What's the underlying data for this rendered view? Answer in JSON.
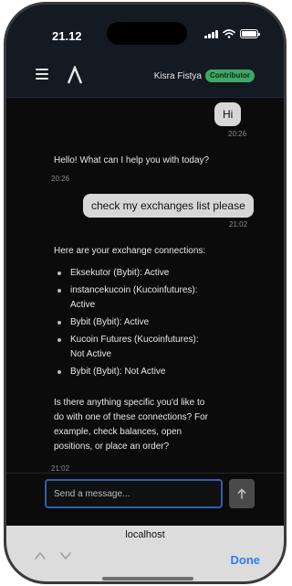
{
  "status_bar": {
    "time": "21.12"
  },
  "header": {
    "user_name": "Kisra Fistya",
    "role_badge": "Contributor",
    "badge_color": "#3ea864"
  },
  "messages": [
    {
      "role": "user",
      "text": "Hi",
      "time": "20:26"
    },
    {
      "role": "assistant",
      "text": "Hello! What can I help you with today?",
      "time": "20:26"
    },
    {
      "role": "user",
      "text": "check my exchanges list please",
      "time": "21:02"
    },
    {
      "role": "assistant",
      "intro": "Here are your exchange connections:",
      "connections": [
        {
          "line1": "Eksekutor (Bybit): Active",
          "line2": ""
        },
        {
          "line1": "instancekucoin (Kucoinfutures):",
          "line2": "Active"
        },
        {
          "line1": "Bybit (Bybit): Active",
          "line2": ""
        },
        {
          "line1": "Kucoin Futures (Kucoinfutures):",
          "line2": "Not Active"
        },
        {
          "line1": "Bybit (Bybit): Not Active",
          "line2": ""
        }
      ],
      "outro_lines": [
        "Is there anything specific you'd like to",
        "do with one of these connections? For",
        "example, check balances, open",
        "positions, or place an order?"
      ],
      "time": "21:02"
    }
  ],
  "composer": {
    "placeholder": "Send a message..."
  },
  "browser": {
    "url": "localhost",
    "done_label": "Done",
    "accent": "#2f7cf6"
  },
  "icons": {
    "menu": "hamburger-menu-icon",
    "logo": "app-logo-icon",
    "send": "send-arrow-icon",
    "prev": "chevron-up-icon",
    "next": "chevron-down-icon"
  }
}
